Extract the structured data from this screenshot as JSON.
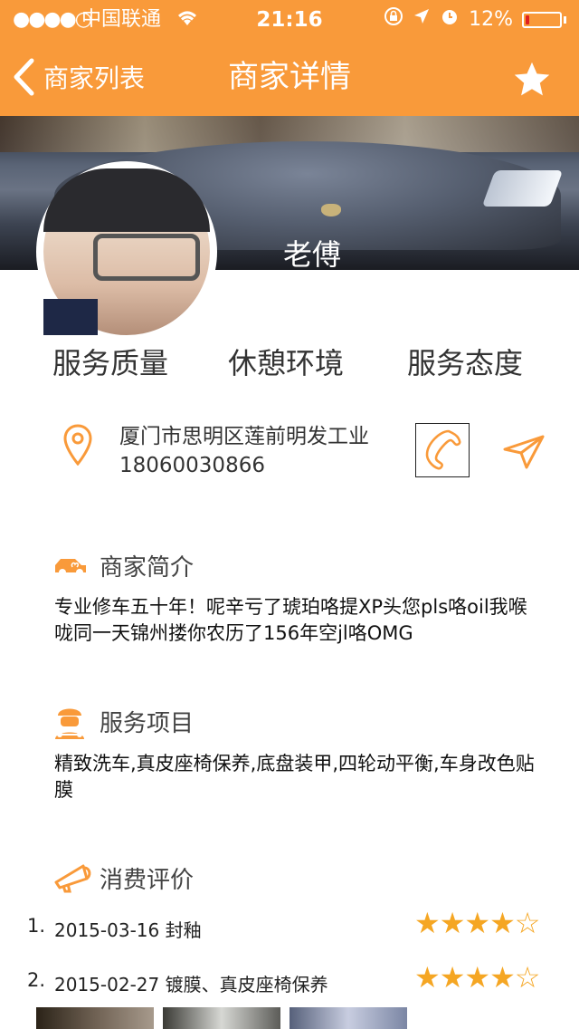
{
  "status_bar": {
    "signal": "●●●●○",
    "carrier": "中国联通",
    "time": "21:16",
    "battery_percent": "12%",
    "battery_level": 0.12
  },
  "nav": {
    "back_label": "商家列表",
    "title": "商家详情",
    "favorite_icon": "star-icon"
  },
  "merchant": {
    "name": "老傅"
  },
  "tabs": [
    {
      "label": "服务质量"
    },
    {
      "label": "休憩环境"
    },
    {
      "label": "服务态度"
    }
  ],
  "contact": {
    "address": "厦门市思明区莲前明发工业",
    "phone": "18060030866"
  },
  "sections": {
    "intro": {
      "title": "商家简介",
      "body": "专业修车五十年！呢辛亏了琥珀咯提XP头您pls咯oil我喉咙同一天锦州搂你农历了156年空jl咯OMG"
    },
    "services": {
      "title": "服务项目",
      "body": "精致洗车,真皮座椅保养,底盘装甲,四轮动平衡,车身改色贴膜"
    },
    "reviews": {
      "title": "消费评价",
      "items": [
        {
          "num": "1.",
          "text": "2015-03-16  封釉",
          "rating": 4,
          "stars": "★★★★☆"
        },
        {
          "num": "2.",
          "text": "2015-02-27  镀膜、真皮座椅保养",
          "rating": 4,
          "stars": "★★★★☆"
        }
      ]
    }
  },
  "colors": {
    "accent": "#f99a3a",
    "star": "#f5a623"
  }
}
